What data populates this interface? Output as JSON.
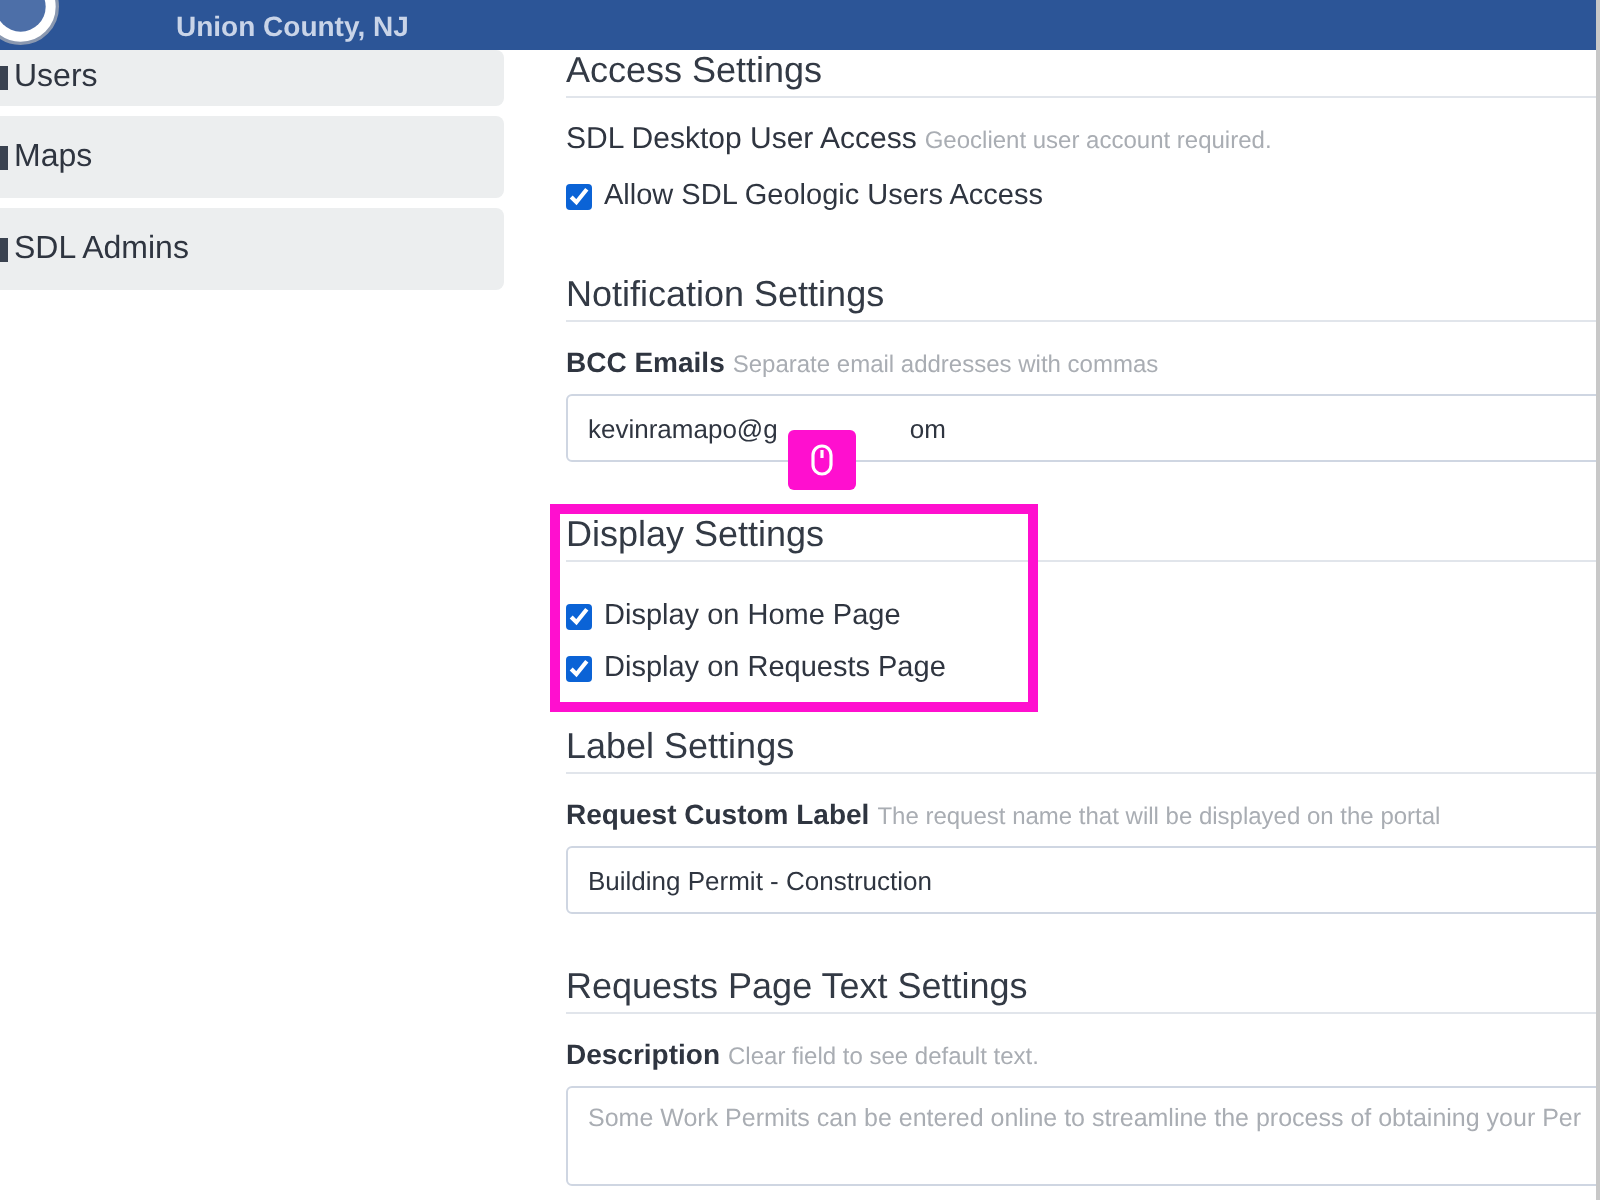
{
  "header": {
    "org": "Union County, NJ"
  },
  "sidebar": {
    "items": [
      {
        "label": "Users"
      },
      {
        "label": "Maps"
      },
      {
        "label": "SDL Admins"
      }
    ]
  },
  "sections": [
    {
      "title": "Access Settings",
      "highlighted": false,
      "fields": [
        {
          "kind": "note",
          "label": "SDL Desktop User Access",
          "hint": "Geoclient user account required."
        },
        {
          "kind": "checkbox",
          "label": "Allow SDL Geologic Users Access",
          "checked": true
        }
      ]
    },
    {
      "title": "Notification Settings",
      "highlighted": false,
      "fields": [
        {
          "kind": "input",
          "label": "BCC Emails",
          "hint": "Separate email addresses with commas",
          "value_parts": [
            "kevinramapo@g",
            "om"
          ]
        }
      ]
    },
    {
      "title": "Display Settings",
      "highlighted": true,
      "fields": [
        {
          "kind": "checkbox",
          "label": "Display on Home Page",
          "checked": true
        },
        {
          "kind": "checkbox",
          "label": "Display on Requests Page",
          "checked": true
        }
      ]
    },
    {
      "title": "Label Settings",
      "highlighted": false,
      "fields": [
        {
          "kind": "input",
          "label": "Request Custom Label",
          "hint": "The request name that will be displayed on the portal",
          "value_parts": [
            "Building Permit - Construction"
          ]
        }
      ]
    },
    {
      "title": "Requests Page Text Settings",
      "highlighted": false,
      "fields": [
        {
          "kind": "textarea",
          "label": "Description",
          "hint": "Clear field to see default text.",
          "placeholder": "Some Work Permits can be entered online to streamline the process of obtaining your Per"
        }
      ]
    }
  ]
}
